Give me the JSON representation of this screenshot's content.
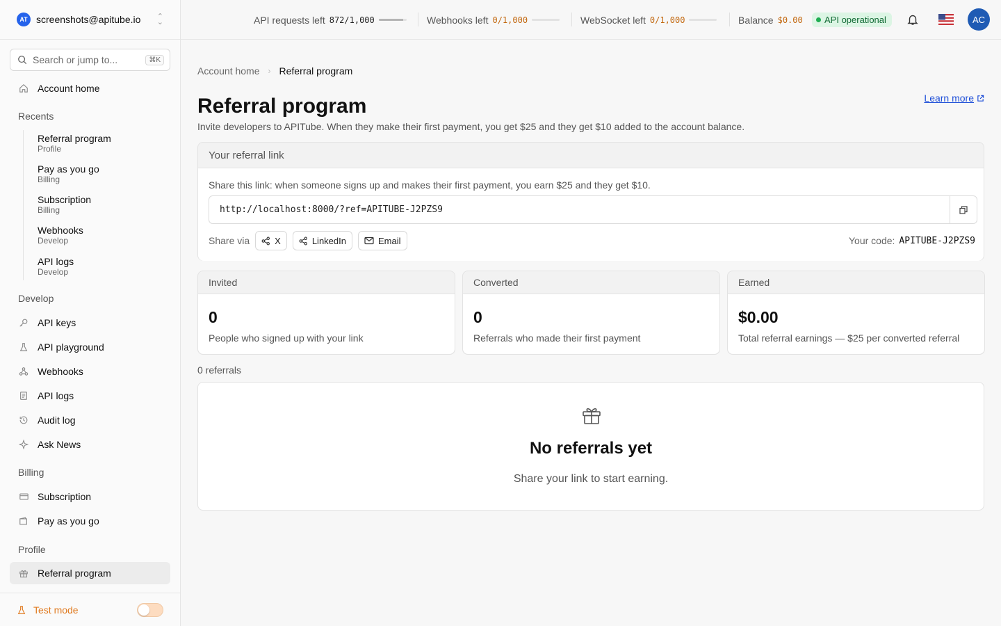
{
  "account": {
    "logo_text": "AT",
    "email": "screenshots@apitube.io"
  },
  "search": {
    "placeholder": "Search or jump to...",
    "shortcut": "⌘K"
  },
  "sidebar": {
    "home": "Account home",
    "recents_label": "Recents",
    "recents": [
      {
        "title": "Referral program",
        "sub": "Profile"
      },
      {
        "title": "Pay as you go",
        "sub": "Billing"
      },
      {
        "title": "Subscription",
        "sub": "Billing"
      },
      {
        "title": "Webhooks",
        "sub": "Develop"
      },
      {
        "title": "API logs",
        "sub": "Develop"
      }
    ],
    "develop_label": "Develop",
    "develop": [
      "API keys",
      "API playground",
      "Webhooks",
      "API logs",
      "Audit log",
      "Ask News"
    ],
    "billing_label": "Billing",
    "billing": [
      "Subscription",
      "Pay as you go"
    ],
    "profile_label": "Profile",
    "profile": [
      "Referral program"
    ],
    "test_mode": "Test mode"
  },
  "topbar": {
    "api_requests_label": "API requests left",
    "api_requests_value": "872/1,000",
    "api_requests_fraction": 0.872,
    "webhooks_label": "Webhooks left",
    "webhooks_value": "0/1,000",
    "webhooks_fraction": 0,
    "websocket_label": "WebSocket left",
    "websocket_value": "0/1,000",
    "websocket_fraction": 0,
    "balance_label": "Balance",
    "balance_value": "$0.00",
    "status": "API operational",
    "avatar": "AC"
  },
  "breadcrumb": {
    "parent": "Account home",
    "current": "Referral program"
  },
  "page": {
    "title": "Referral program",
    "learn_more": "Learn more",
    "subtitle": "Invite developers to APITube. When they make their first payment, you get $25 and they get $10 added to the account balance."
  },
  "referral_link": {
    "heading": "Your referral link",
    "share_text": "Share this link: when someone signs up and makes their first payment, you earn $25 and they get $10.",
    "url": "http://localhost:8000/?ref=APITUBE-J2PZS9",
    "share_via": "Share via",
    "share_x": "X",
    "share_linkedin": "LinkedIn",
    "share_email": "Email",
    "code_label": "Your code:",
    "code": "APITUBE-J2PZS9"
  },
  "stats": [
    {
      "label": "Invited",
      "value": "0",
      "desc": "People who signed up with your link"
    },
    {
      "label": "Converted",
      "value": "0",
      "desc": "Referrals who made their first payment"
    },
    {
      "label": "Earned",
      "value": "$0.00",
      "desc": "Total referral earnings — $25 per converted referral"
    }
  ],
  "referrals": {
    "count_text": "0 referrals",
    "empty_title": "No referrals yet",
    "empty_desc": "Share your link to start earning."
  }
}
